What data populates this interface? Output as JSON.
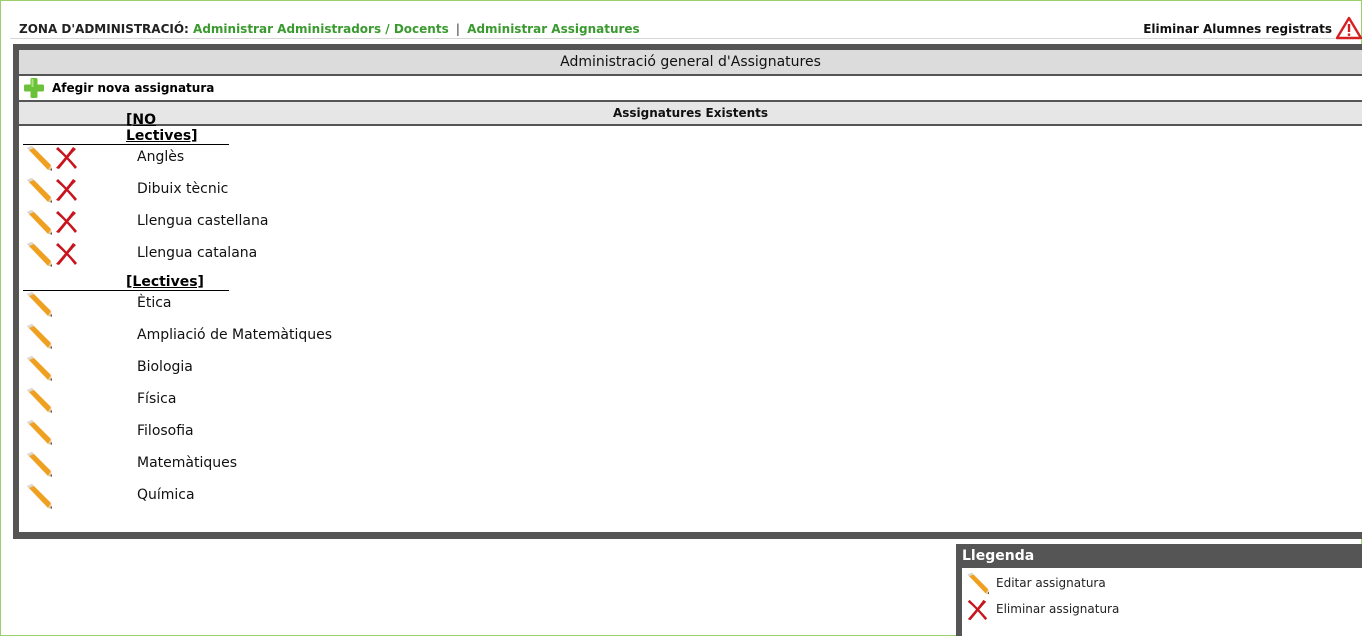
{
  "topbar": {
    "zona_label": "ZONA D'ADMINISTRACIÓ:",
    "link_admins": "Administrar Administradors / Docents",
    "separator": "|",
    "link_assignatures": "Administrar Assignatures",
    "eliminar_alumnes": "Eliminar Alumnes registrats",
    "warning_icon": "warning-triangle-icon"
  },
  "panel": {
    "title": "Administració general d'Assignatures",
    "add_label": "Afegir nova assignatura",
    "subtitle": "Assignatures Existents",
    "groups": [
      {
        "label": "[NO Lectives]",
        "items": [
          "Anglès",
          "Dibuix tècnic",
          "Llengua castellana",
          "Llengua catalana"
        ]
      },
      {
        "label": "[Lectives]",
        "items": [
          "Ètica",
          "Ampliació de Matemàtiques",
          "Biologia",
          "Física",
          "Filosofia",
          "Matemàtiques",
          "Química"
        ]
      }
    ]
  },
  "legend": {
    "title": "Llegenda",
    "edit_label": "Editar assignatura",
    "delete_label": "Eliminar assignatura"
  },
  "colors": {
    "link_green": "#3a9a2f",
    "panel_dark": "#555555",
    "frame_green": "#9bcf6e",
    "delete_red": "#c8141c",
    "pencil_orange": "#f0a020"
  }
}
